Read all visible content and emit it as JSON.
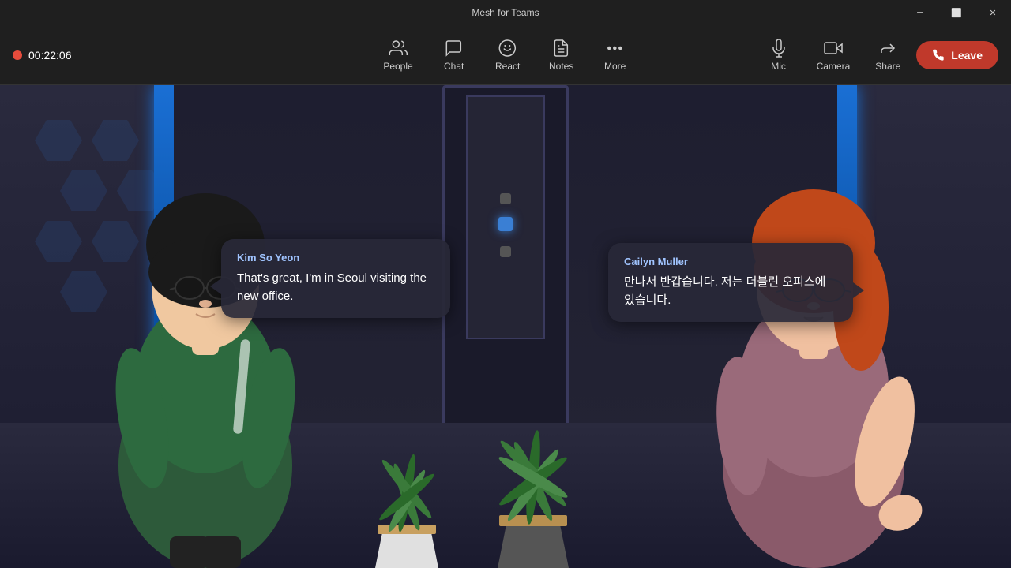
{
  "window": {
    "title": "Mesh for Teams"
  },
  "titlebar": {
    "minimize_label": "─",
    "maximize_label": "⬜",
    "close_label": "✕"
  },
  "recording": {
    "timer": "00:22:06"
  },
  "toolbar": {
    "people_label": "People",
    "chat_label": "Chat",
    "react_label": "React",
    "notes_label": "Notes",
    "more_label": "More",
    "mic_label": "Mic",
    "camera_label": "Camera",
    "share_label": "Share",
    "leave_label": "Leave"
  },
  "bubbles": {
    "left": {
      "name": "Kim So Yeon",
      "text": "That's great, I'm in Seoul visiting the new office."
    },
    "right": {
      "name": "Cailyn Muller",
      "text": "만나서 반갑습니다. 저는 더블린 오피스에 있습니다."
    }
  }
}
